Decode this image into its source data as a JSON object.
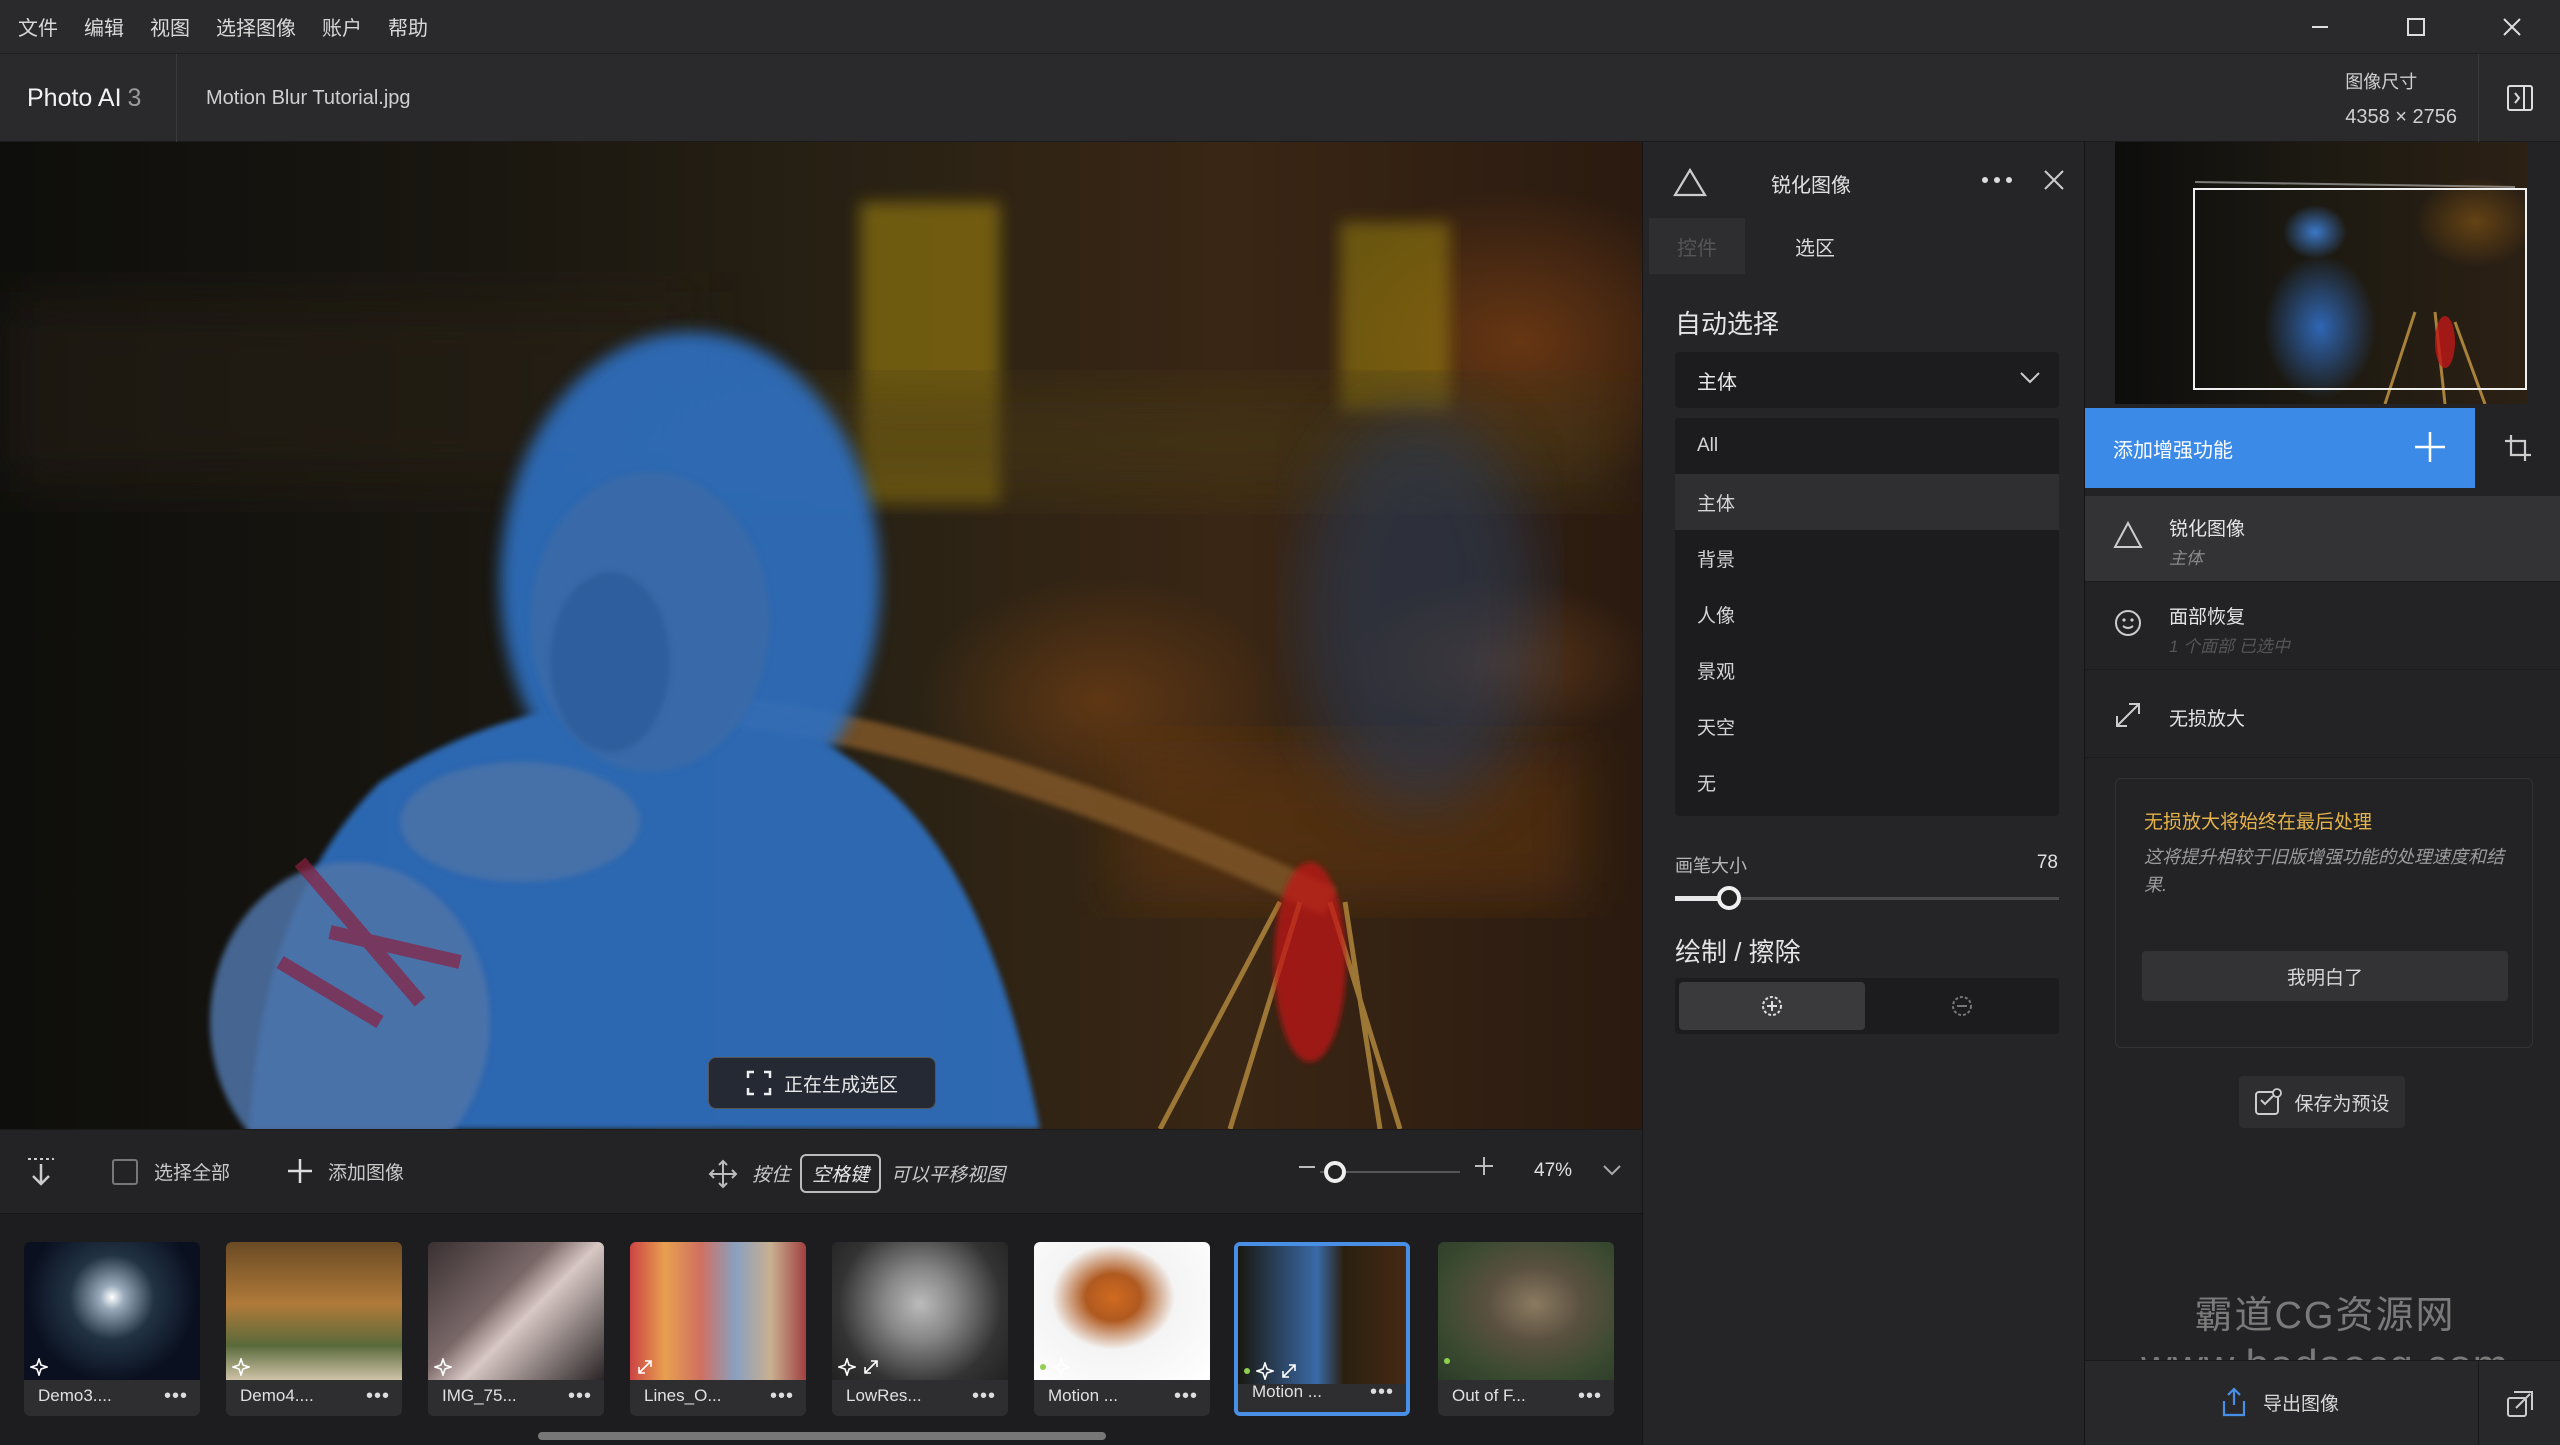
{
  "menu": [
    "文件",
    "编辑",
    "视图",
    "选择图像",
    "账户",
    "帮助"
  ],
  "app": {
    "name": "Photo AI",
    "version": "3"
  },
  "file": {
    "name": "Motion Blur Tutorial.jpg"
  },
  "image_size": {
    "label": "图像尺寸",
    "value": "4358 × 2756"
  },
  "canvas": {
    "status": "正在生成选区"
  },
  "toolbar": {
    "select_all": "选择全部",
    "add_image": "添加图像",
    "hint_prefix": "按住",
    "hint_key": "空格键",
    "hint_suffix": "可以平移视图",
    "zoom": "47%"
  },
  "thumbnails": [
    {
      "label": "Demo3....",
      "theme": "fireworks",
      "badges": [
        "sparkle"
      ],
      "dot": false,
      "selected": false
    },
    {
      "label": "Demo4....",
      "theme": "interior",
      "badges": [
        "sparkle"
      ],
      "dot": false,
      "selected": false
    },
    {
      "label": "IMG_75...",
      "theme": "portrait",
      "badges": [
        "sparkle"
      ],
      "dot": false,
      "selected": false
    },
    {
      "label": "Lines_O...",
      "theme": "houses",
      "badges": [
        "resize"
      ],
      "dot": false,
      "selected": false
    },
    {
      "label": "LowRes...",
      "theme": "bw-portrait",
      "badges": [
        "sparkle",
        "resize"
      ],
      "dot": false,
      "selected": false
    },
    {
      "label": "Motion ...",
      "theme": "fox",
      "badges": [
        "sparkle"
      ],
      "dot": true,
      "selected": false
    },
    {
      "label": "Motion ...",
      "theme": "motion",
      "badges": [
        "sparkle",
        "resize"
      ],
      "dot": true,
      "selected": true
    },
    {
      "label": "Out of F...",
      "theme": "owl",
      "badges": [],
      "dot": true,
      "selected": false
    }
  ],
  "sharpen_panel": {
    "title": "锐化图像",
    "tabs": [
      "控件",
      "选区"
    ],
    "auto_select_title": "自动选择",
    "dropdown_value": "主体",
    "options": [
      "All",
      "主体",
      "背景",
      "人像",
      "景观",
      "天空",
      "无"
    ],
    "selected_option": "主体",
    "brush_label": "画笔大小",
    "brush_value": "78",
    "brush_fraction": 0.14,
    "paint_title": "绘制 / 擦除"
  },
  "right_panel": {
    "add_enhancement": "添加增强功能",
    "enhancements": [
      {
        "title": "锐化图像",
        "subtitle": "主体",
        "icon": "triangle-icon",
        "active": true
      },
      {
        "title": "面部恢复",
        "subtitle": "1 个面部 已选中",
        "icon": "face-icon",
        "active": false
      },
      {
        "title": "无损放大",
        "subtitle": "",
        "icon": "expand-icon",
        "active": false
      }
    ],
    "notice": {
      "title": "无损放大将始终在最后处理",
      "body": "这将提升相较于旧版增强功能的处理速度和结果.",
      "button": "我明白了"
    },
    "save_preset": "保存为预设",
    "export": "导出图像"
  },
  "watermark": {
    "line1": "霸道CG资源网",
    "line2": "www.badaocg.com"
  },
  "colors": {
    "accent": "#3b8ae8",
    "notice_title": "#e6b34a",
    "selection_mask": "#2f6fc0"
  }
}
